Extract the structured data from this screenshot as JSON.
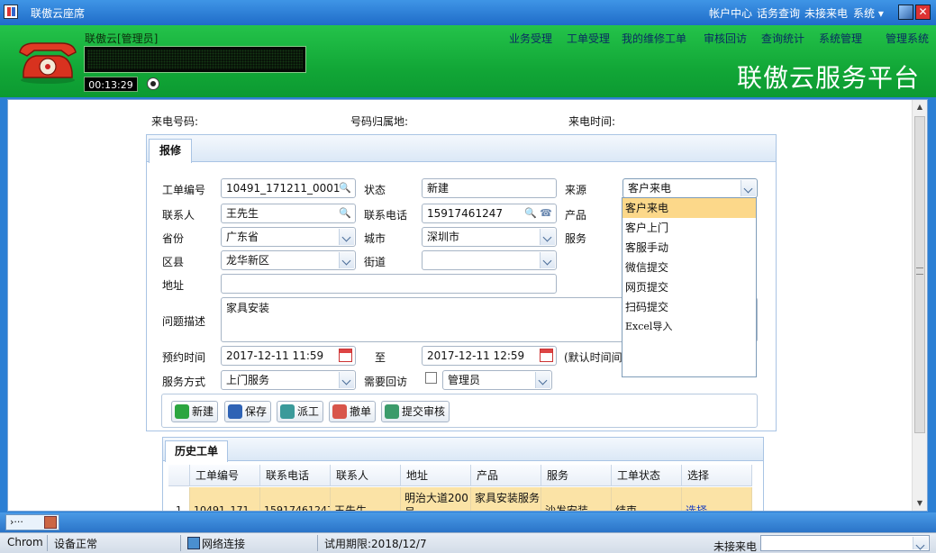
{
  "window": {
    "title": "联傲云座席",
    "menu": [
      "帐户中心",
      "话务查询",
      "未接来电",
      "系统"
    ]
  },
  "header": {
    "user": "联傲云[管理员]",
    "timer": "00:13:29",
    "platform_title": "联傲云服务平台",
    "nav": [
      "业务受理",
      "工单受理",
      "我的维修工单",
      "审核回访",
      "查询统计",
      "系统管理",
      "管理系统"
    ]
  },
  "callinfo": {
    "number_label": "来电号码:",
    "region_label": "号码归属地:",
    "time_label": "来电时间:"
  },
  "repair": {
    "tab": "报修",
    "labels": {
      "order_no": "工单编号",
      "status": "状态",
      "source": "来源",
      "contact": "联系人",
      "phone": "联系电话",
      "product": "产品",
      "province": "省份",
      "city": "城市",
      "service": "服务",
      "district": "区县",
      "street": "街道",
      "address": "地址",
      "problem": "问题描述",
      "appoint": "预约时间",
      "to": "至",
      "default_note": "(默认时间间",
      "service_mode": "服务方式",
      "need_visit": "需要回访"
    },
    "values": {
      "order_no": "10491_171211_0001",
      "status": "新建",
      "source": "客户来电",
      "contact": "王先生",
      "phone": "15917461247",
      "province": "广东省",
      "city": "深圳市",
      "district": "龙华新区",
      "street": "",
      "address": "",
      "problem": "家具安装",
      "appoint_start": "2017-12-11 11:59",
      "appoint_end": "2017-12-11 12:59",
      "service_mode": "上门服务",
      "visitor": "管理员"
    },
    "source_options": [
      "客户来电",
      "客户上门",
      "客服手动",
      "微信提交",
      "网页提交",
      "扫码提交",
      "Excel导入"
    ],
    "buttons": {
      "new": "新建",
      "save": "保存",
      "dispatch": "派工",
      "revoke": "撤单",
      "submit": "提交审核"
    }
  },
  "history": {
    "tab": "历史工单",
    "columns": [
      "工单编号",
      "联系电话",
      "联系人",
      "地址",
      "产品",
      "服务",
      "工单状态",
      "选择"
    ],
    "rows": [
      {
        "index": "1",
        "order_no": "10491_171...",
        "phone": "15917461247",
        "contact": "王先生",
        "address": "明治大道200号",
        "product": "家具安装服务",
        "service": "沙发安装",
        "status": "结束",
        "select": "选择"
      }
    ]
  },
  "taskbar": {
    "item": "›···"
  },
  "statusbar": {
    "browser": "Chrom",
    "device": "设备正常",
    "network": "网络连接",
    "trial": "试用期限:2018/12/7",
    "missed": "未接来电"
  },
  "colors": {
    "header_green": "#12a737",
    "title_blue": "#2b7fd4",
    "selected_option": "#fcd88a",
    "row_highlight": "#fbe3a6"
  }
}
